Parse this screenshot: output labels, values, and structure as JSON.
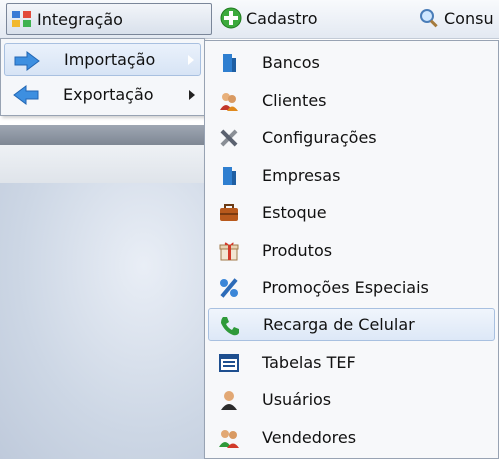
{
  "menubar": {
    "items": [
      {
        "label": "Integração",
        "icon": "integration-icon",
        "active": true
      },
      {
        "label": "Cadastro",
        "icon": "green-plus-icon"
      },
      {
        "label": "Consu",
        "icon": "magnifier-icon"
      }
    ]
  },
  "submenu": {
    "items": [
      {
        "label": "Importação",
        "icon": "right-arrow-icon",
        "has_submenu": true,
        "highlighted": true
      },
      {
        "label": "Exportação",
        "icon": "left-arrow-icon",
        "has_submenu": true
      }
    ]
  },
  "dropdown": {
    "items": [
      {
        "label": "Bancos",
        "icon": "bank-icon"
      },
      {
        "label": "Clientes",
        "icon": "clients-icon"
      },
      {
        "label": "Configurações",
        "icon": "tools-icon"
      },
      {
        "label": "Empresas",
        "icon": "building-icon"
      },
      {
        "label": "Estoque",
        "icon": "briefcase-icon"
      },
      {
        "label": "Produtos",
        "icon": "gift-icon"
      },
      {
        "label": "Promoções Especiais",
        "icon": "percent-icon"
      },
      {
        "label": "Recarga de Celular",
        "icon": "phone-icon",
        "highlighted": true
      },
      {
        "label": "Tabelas TEF",
        "icon": "table-icon"
      },
      {
        "label": "Usuários",
        "icon": "user-icon"
      },
      {
        "label": "Vendedores",
        "icon": "sellers-icon"
      }
    ]
  },
  "colors": {
    "highlight": "#dde8f7",
    "highlight_border": "#a8c0e0",
    "menu_border": "#98a3b3"
  }
}
